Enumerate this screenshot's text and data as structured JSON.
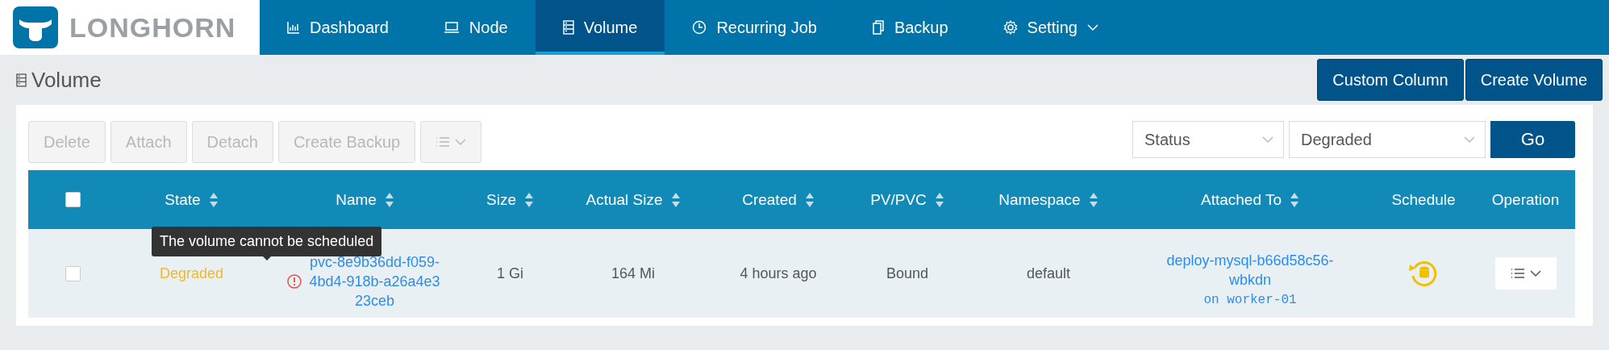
{
  "logo": {
    "text": "LONGHORN"
  },
  "nav": [
    {
      "label": "Dashboard",
      "selected": false,
      "dropdown": false
    },
    {
      "label": "Node",
      "selected": false,
      "dropdown": false
    },
    {
      "label": "Volume",
      "selected": true,
      "dropdown": false
    },
    {
      "label": "Recurring Job",
      "selected": false,
      "dropdown": false
    },
    {
      "label": "Backup",
      "selected": false,
      "dropdown": false
    },
    {
      "label": "Setting",
      "selected": false,
      "dropdown": true
    }
  ],
  "page": {
    "title": "Volume",
    "buttons": [
      "Custom Column",
      "Create Volume"
    ]
  },
  "toolbar": {
    "buttons": [
      {
        "label": "Delete",
        "disabled": true
      },
      {
        "label": "Attach",
        "disabled": true
      },
      {
        "label": "Detach",
        "disabled": true
      },
      {
        "label": "Create Backup",
        "disabled": true
      }
    ],
    "menu_disabled": true
  },
  "filter": {
    "field": "Status",
    "value": "Degraded",
    "button": "Go"
  },
  "table": {
    "select_all_checked": false,
    "columns": [
      {
        "label": "State",
        "sortable": true
      },
      {
        "label": "Name",
        "sortable": true
      },
      {
        "label": "Size",
        "sortable": true
      },
      {
        "label": "Actual Size",
        "sortable": true
      },
      {
        "label": "Created",
        "sortable": true
      },
      {
        "label": "PV/PVC",
        "sortable": true
      },
      {
        "label": "Namespace",
        "sortable": true
      },
      {
        "label": "Attached To",
        "sortable": true
      },
      {
        "label": "Schedule",
        "sortable": false
      },
      {
        "label": "Operation",
        "sortable": false
      }
    ],
    "rows": [
      {
        "checked": false,
        "state": "Degraded",
        "warning": true,
        "tooltip": "The volume cannot be scheduled",
        "name": "pvc-8e9b36dd-f059-4bd4-918b-a26a4e323ceb",
        "size": "1 Gi",
        "actual_size": "164 Mi",
        "created": "4 hours ago",
        "pv_pvc": "Bound",
        "namespace": "default",
        "attached_to": "deploy-mysql-b66d58c56-wbkdn",
        "attached_node": "on worker-01"
      }
    ]
  }
}
